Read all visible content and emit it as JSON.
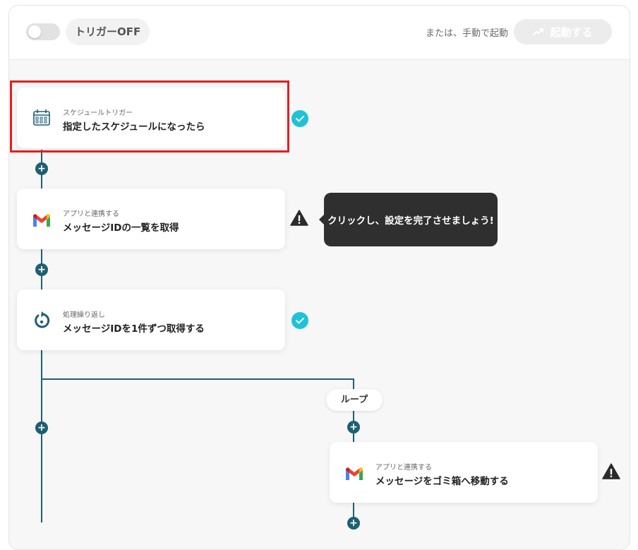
{
  "header": {
    "trigger_label": "トリガーOFF",
    "manual_text": "または、手動で起動",
    "start_button_label": "起動する"
  },
  "steps": [
    {
      "sub": "スケジュールトリガー",
      "title": "指定したスケジュールになったら",
      "icon": "calendar-icon",
      "status": "complete"
    },
    {
      "sub": "アプリと連携する",
      "title": "メッセージIDの一覧を取得",
      "icon": "gmail-icon",
      "status": "warning"
    },
    {
      "sub": "処理繰り返し",
      "title": "メッセージIDを1件ずつ取得する",
      "icon": "loop-icon",
      "status": "complete"
    },
    {
      "sub": "アプリと連携する",
      "title": "メッセージをゴミ箱へ移動する",
      "icon": "gmail-icon",
      "status": "warning"
    }
  ],
  "tooltip": {
    "text": "クリックし、設定を完了させましょう!"
  },
  "loop_label": "ループ",
  "colors": {
    "accent": "#1e5f73",
    "check": "#1fc2d6",
    "highlight": "#e0201f",
    "tooltip_bg": "#2f2f2f"
  }
}
